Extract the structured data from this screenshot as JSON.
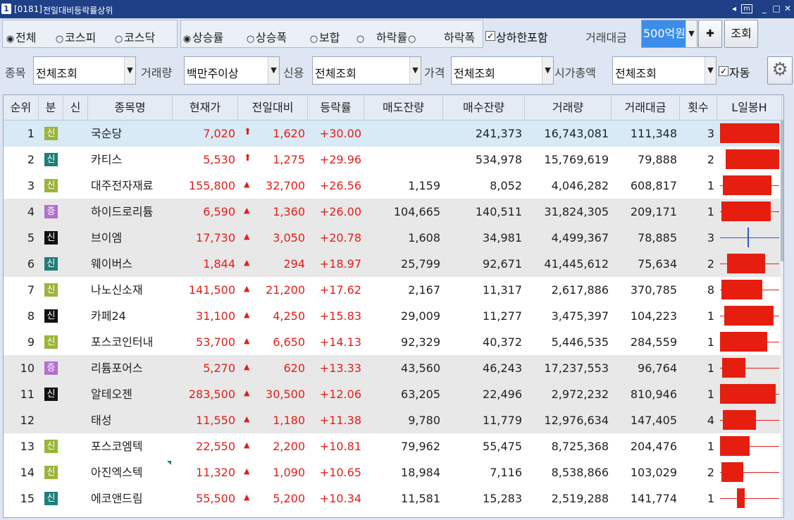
{
  "window": {
    "badge": "1",
    "code": "[0181]",
    "title": "전일대비등락률상위",
    "controls": [
      "◂",
      "m",
      "_",
      "□",
      "✕"
    ]
  },
  "filters": {
    "market": {
      "options": [
        "전체",
        "코스피",
        "코스닥"
      ],
      "selected": 0
    },
    "sort": {
      "options": [
        "상승률",
        "상승폭",
        "보합",
        "하락률",
        "하락폭"
      ],
      "selected": 0
    },
    "limit_checkbox": {
      "label": "상하한포함",
      "checked": true
    },
    "amount_label": "거래대금",
    "amount_value": "500억원",
    "query_button": "조회",
    "stock_label": "종목",
    "stock_value": "전체조회",
    "volume_label": "거래량",
    "volume_value": "백만주이상",
    "credit_label": "신용",
    "credit_value": "전체조회",
    "price_label": "가격",
    "price_value": "전체조회",
    "mcap_label": "시가총액",
    "mcap_value": "전체조회",
    "auto_checkbox": {
      "label": "자동",
      "checked": true
    }
  },
  "table": {
    "headers": [
      "순위",
      "분",
      "신",
      "종목명",
      "현재가",
      "전일대비",
      "등락률",
      "매도잔량",
      "매수잔량",
      "거래량",
      "거래대금",
      "횟수",
      "L일봉H"
    ],
    "rows": [
      {
        "rank": "1",
        "tag": "신",
        "tag_style": "olive",
        "name": "국순당",
        "price": "7,020",
        "arrow": "⬆",
        "change": "1,620",
        "rate": "+30.00",
        "ask": "",
        "bid": "241,373",
        "volume": "16,743,081",
        "amount": "111,348",
        "count": "3",
        "candle": {
          "body": [
            0.0,
            1.0
          ],
          "wick": [
            0.0,
            1.0
          ]
        }
      },
      {
        "rank": "2",
        "tag": "신",
        "tag_style": "teal",
        "name": "카티스",
        "price": "5,530",
        "arrow": "⬆",
        "change": "1,275",
        "rate": "+29.96",
        "ask": "",
        "bid": "534,978",
        "volume": "15,769,619",
        "amount": "79,888",
        "count": "2",
        "candle": {
          "body": [
            0.09,
            1.0
          ],
          "wick": [
            0.09,
            1.0
          ]
        }
      },
      {
        "rank": "3",
        "tag": "신",
        "tag_style": "olive",
        "name": "대주전자재료",
        "price": "155,800",
        "arrow": "▲",
        "change": "32,700",
        "rate": "+26.56",
        "ask": "1,159",
        "bid": "8,052",
        "volume": "4,046,282",
        "amount": "608,817",
        "count": "1",
        "candle": {
          "body": [
            0.05,
            0.87
          ],
          "wick": [
            0.0,
            1.0
          ]
        }
      },
      {
        "rank": "4",
        "tag": "증",
        "tag_style": "purple",
        "name": "하이드로리튬",
        "price": "6,590",
        "arrow": "▲",
        "change": "1,360",
        "rate": "+26.00",
        "ask": "104,665",
        "bid": "140,511",
        "volume": "31,824,305",
        "amount": "209,171",
        "count": "1",
        "candle": {
          "body": [
            0.02,
            0.86
          ],
          "wick": [
            0.0,
            1.0
          ]
        }
      },
      {
        "rank": "5",
        "tag": "신",
        "tag_style": "black",
        "name": "브이엠",
        "price": "17,730",
        "arrow": "▲",
        "change": "3,050",
        "rate": "+20.78",
        "ask": "1,608",
        "bid": "34,981",
        "volume": "4,499,367",
        "amount": "78,885",
        "count": "3",
        "candle": {
          "body": [
            0.46,
            0.48
          ],
          "wick": [
            0.0,
            1.0
          ],
          "doji": true
        }
      },
      {
        "rank": "6",
        "tag": "신",
        "tag_style": "teal",
        "name": "웨이버스",
        "price": "1,844",
        "arrow": "▲",
        "change": "294",
        "rate": "+18.97",
        "ask": "25,799",
        "bid": "92,671",
        "volume": "41,445,612",
        "amount": "75,634",
        "count": "2",
        "candle": {
          "body": [
            0.12,
            0.76
          ],
          "wick": [
            0.0,
            1.0
          ]
        }
      },
      {
        "rank": "7",
        "tag": "신",
        "tag_style": "olive",
        "name": "나노신소재",
        "price": "141,500",
        "arrow": "▲",
        "change": "21,200",
        "rate": "+17.62",
        "ask": "2,167",
        "bid": "11,317",
        "volume": "2,617,886",
        "amount": "370,785",
        "count": "8",
        "candle": {
          "body": [
            0.02,
            0.72
          ],
          "wick": [
            0.0,
            1.0
          ]
        }
      },
      {
        "rank": "8",
        "tag": "신",
        "tag_style": "black",
        "name": "카페24",
        "price": "31,100",
        "arrow": "▲",
        "change": "4,250",
        "rate": "+15.83",
        "ask": "29,009",
        "bid": "11,277",
        "volume": "3,475,397",
        "amount": "104,223",
        "count": "1",
        "candle": {
          "body": [
            0.07,
            0.9
          ],
          "wick": [
            0.0,
            1.0
          ]
        }
      },
      {
        "rank": "9",
        "tag": "신",
        "tag_style": "olive",
        "name": "포스코인터내",
        "price": "53,700",
        "arrow": "▲",
        "change": "6,650",
        "rate": "+14.13",
        "ask": "92,329",
        "bid": "40,372",
        "volume": "5,446,535",
        "amount": "284,559",
        "count": "1",
        "candle": {
          "body": [
            0.0,
            0.8
          ],
          "wick": [
            0.0,
            1.0
          ]
        }
      },
      {
        "rank": "10",
        "tag": "증",
        "tag_style": "purple",
        "name": "리튬포어스",
        "price": "5,270",
        "arrow": "▲",
        "change": "620",
        "rate": "+13.33",
        "ask": "43,560",
        "bid": "46,243",
        "volume": "17,237,553",
        "amount": "96,764",
        "count": "1",
        "candle": {
          "body": [
            0.04,
            0.43
          ],
          "wick": [
            0.0,
            1.0
          ]
        }
      },
      {
        "rank": "11",
        "tag": "신",
        "tag_style": "black",
        "name": "알테오젠",
        "price": "283,500",
        "arrow": "▲",
        "change": "30,500",
        "rate": "+12.06",
        "ask": "63,205",
        "bid": "22,496",
        "volume": "2,972,232",
        "amount": "810,946",
        "count": "1",
        "candle": {
          "body": [
            0.0,
            0.94
          ],
          "wick": [
            0.0,
            1.0
          ]
        }
      },
      {
        "rank": "12",
        "tag": "",
        "tag_style": "none",
        "name": "태성",
        "price": "11,550",
        "arrow": "▲",
        "change": "1,180",
        "rate": "+11.38",
        "ask": "9,780",
        "bid": "11,779",
        "volume": "12,976,634",
        "amount": "147,405",
        "count": "4",
        "candle": {
          "body": [
            0.05,
            0.61
          ],
          "wick": [
            0.0,
            1.0
          ]
        }
      },
      {
        "rank": "13",
        "tag": "신",
        "tag_style": "olive",
        "name": "포스코엠텍",
        "price": "22,550",
        "arrow": "▲",
        "change": "2,200",
        "rate": "+10.81",
        "ask": "79,962",
        "bid": "55,475",
        "volume": "8,725,368",
        "amount": "204,476",
        "count": "1",
        "candle": {
          "body": [
            0.0,
            0.5
          ],
          "wick": [
            0.0,
            1.0
          ]
        }
      },
      {
        "rank": "14",
        "tag": "신",
        "tag_style": "olive",
        "name": "아진엑스텍",
        "price": "11,320",
        "arrow": "▲",
        "change": "1,090",
        "rate": "+10.65",
        "ask": "18,984",
        "bid": "7,116",
        "volume": "8,538,866",
        "amount": "103,029",
        "count": "2",
        "candle": {
          "body": [
            0.02,
            0.39
          ],
          "wick": [
            0.0,
            1.0
          ]
        }
      },
      {
        "rank": "15",
        "tag": "신",
        "tag_style": "teal",
        "name": "에코앤드림",
        "price": "55,500",
        "arrow": "▲",
        "change": "5,200",
        "rate": "+10.34",
        "ask": "11,581",
        "bid": "15,283",
        "volume": "2,519,288",
        "amount": "141,774",
        "count": "1",
        "candle": {
          "body": [
            0.28,
            0.42
          ],
          "wick": [
            0.0,
            1.0
          ]
        }
      }
    ]
  },
  "colors": {
    "selected_row": "#d7eaf5",
    "shaded_row": "#e8e8e8",
    "up": "#e0201b",
    "tag_olive": "#9ab53a",
    "tag_teal": "#1e7f78",
    "tag_purple": "#b26fcf",
    "tag_black": "#111111",
    "accent_blue": "#3a8eea"
  }
}
